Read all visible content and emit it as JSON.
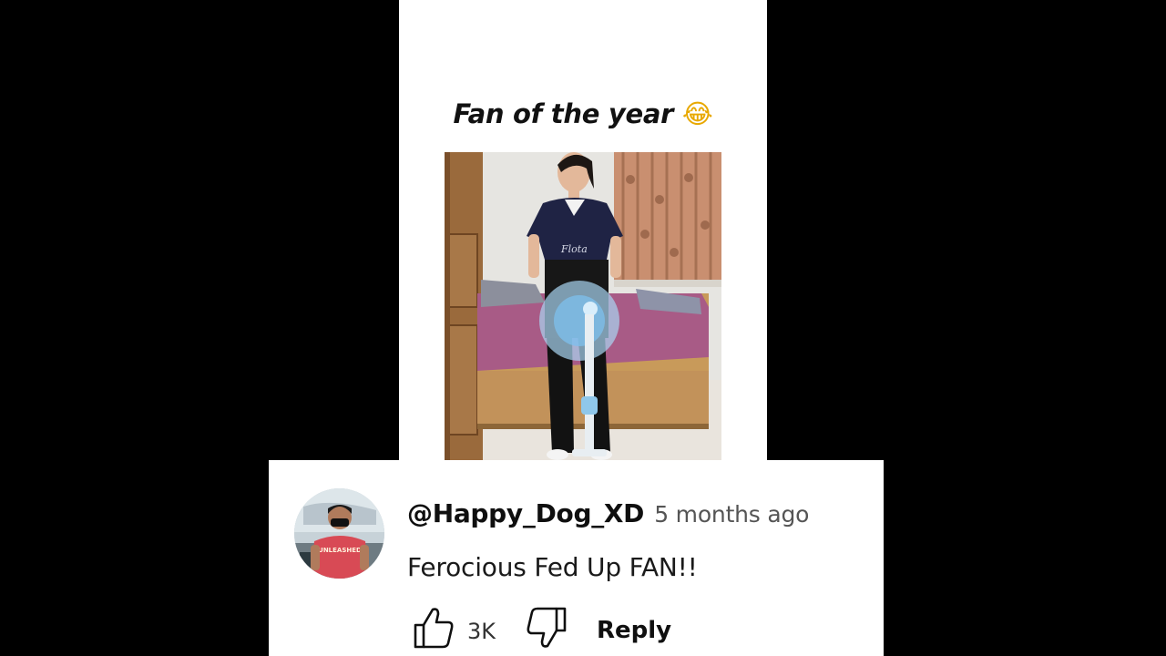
{
  "post": {
    "title": "Fan of the year",
    "title_emoji": "😂"
  },
  "comment": {
    "username": "@Happy_Dog_XD",
    "timestamp": "5 months ago",
    "text": "Ferocious Fed Up FAN!!",
    "likes": "3K",
    "reply_label": "Reply",
    "avatar_shirt_text": "UNLEASHED"
  },
  "colors": {
    "background": "#000000",
    "panel": "#ffffff",
    "text_primary": "#0f0f0f",
    "text_secondary": "#555555"
  },
  "icons": {
    "like": "thumbs-up-icon",
    "dislike": "thumbs-down-icon"
  }
}
